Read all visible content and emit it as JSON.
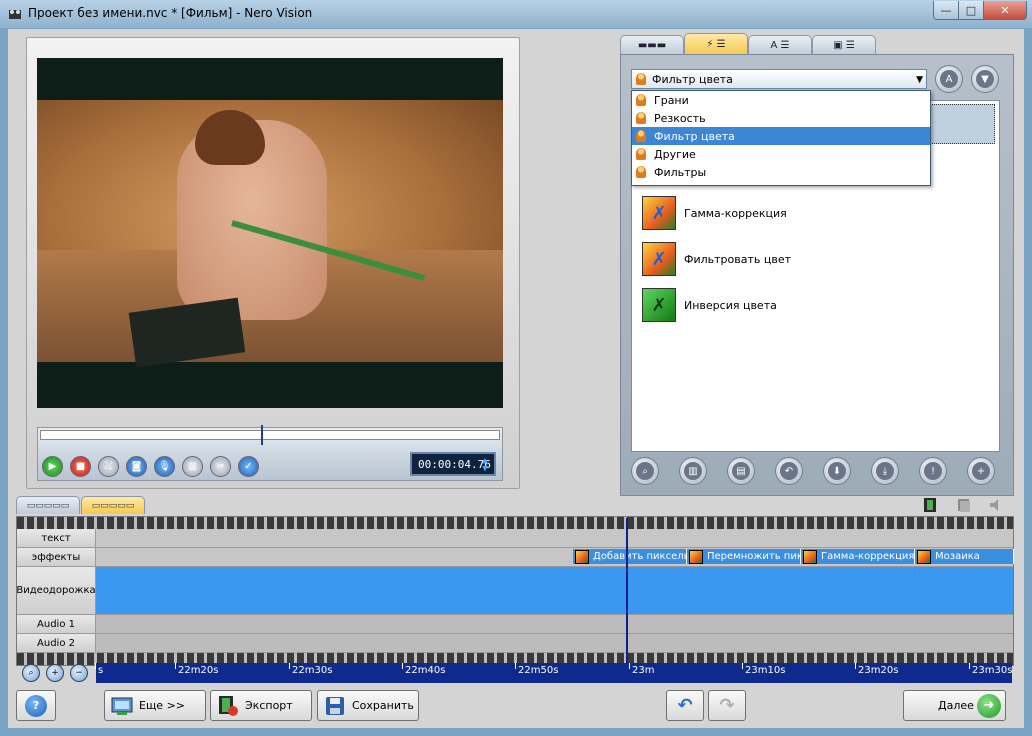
{
  "window": {
    "title": "Проект без имени.nvc * [Фильм] - Nero Vision",
    "minimize_label": "—",
    "maximize_label": "□",
    "close_label": "✕"
  },
  "preview": {
    "time_prefix": "00:00:",
    "time_value": "04.76",
    "scrub_position": 0.48
  },
  "right_panel": {
    "tabs": [
      "▬▬▬",
      "⚡ ☰",
      "A ☰",
      "▣ ☰"
    ],
    "active_tab": 1,
    "category_selected": "Фильтр цвета",
    "dropdown_options": [
      "Грани",
      "Резкость",
      "Фильтр цвета",
      "Другие",
      "Фильтры"
    ],
    "dropdown_selected_index": 2,
    "effects": [
      "Гамма-коррекция",
      "Фильтровать цвет",
      "Инверсия цвета"
    ],
    "side_button_a": "A",
    "icons": [
      "search-icon",
      "film-icon",
      "clip-icon",
      "undo-icon",
      "move-down-icon",
      "move-bottom-icon",
      "info-icon",
      "add-icon"
    ]
  },
  "timeline": {
    "tabs": [
      "▭▭▭▭▭",
      "▭▭▭▭▭"
    ],
    "tracks": [
      {
        "label": "текст"
      },
      {
        "label": "эффекты"
      },
      {
        "label": "Видеодорожка"
      },
      {
        "label": "Audio 1"
      },
      {
        "label": "Audio 2"
      }
    ],
    "effect_clips": [
      "Добавить пиксель",
      "Перемножить пикс",
      "Гамма-коррекция",
      "Мозаика"
    ],
    "ruler_ticks": [
      "s",
      "22m20s",
      "22m30s",
      "22m40s",
      "22m50s",
      "23m",
      "23m10s",
      "23m20s",
      "23m30s"
    ],
    "video_color": "#3b98f0"
  },
  "bottom": {
    "help_label": "?",
    "more_label": "Еще >>",
    "export_label": "Экспорт",
    "save_label": "Сохранить",
    "next_label": "Далее"
  }
}
